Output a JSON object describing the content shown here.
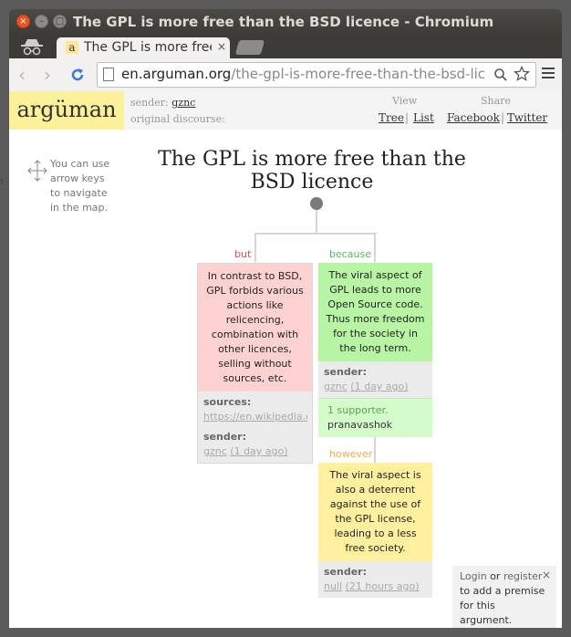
{
  "window": {
    "title": "The GPL is more free than the BSD licence - Chromium",
    "close": "×",
    "min": "–",
    "max": "□"
  },
  "tab": {
    "label": "The GPL is more free than the BSD licence",
    "close": "×",
    "favicon": "a"
  },
  "address": {
    "host": "en.arguman.org",
    "path": "/the-gpl-is-more-free-than-the-bsd-licence"
  },
  "site": {
    "logo": "argüman",
    "sender_label": "sender:",
    "sender_name": "gznc",
    "discourse_label": "original discourse:",
    "view_label": "View",
    "share_label": "Share",
    "tree": "Tree",
    "list": "List",
    "facebook": "Facebook",
    "twitter": "Twitter",
    "sep": "|"
  },
  "hint": "You can use arrow keys to navigate in the map.",
  "argument": {
    "title": "The GPL is more free than the BSD licence"
  },
  "premises": [
    {
      "relation": "but",
      "text": "In contrast to BSD, GPL forbids various actions like relicencing, combination with other licences, selling without sources, etc.",
      "sources_label": "sources:",
      "sources": "https://en.wikipedia.org/wiki/GNU_General_Public_License",
      "sender_label": "sender:",
      "sender": "gznc",
      "time": "(1 day ago)"
    },
    {
      "relation": "because",
      "text": "The viral aspect of GPL leads to more Open Source code. Thus more freedom for the society in the long term.",
      "sender_label": "sender:",
      "sender": "gznc",
      "time": "(1 day ago)",
      "supporters": "1 supporter.",
      "supporter_name": "pranavashok"
    },
    {
      "relation": "however",
      "text": "The viral aspect is also a deterrent against the use of the GPL license, leading to a less free society.",
      "sender_label": "sender:",
      "sender": "null",
      "time": "(21 hours ago)"
    }
  ],
  "login": {
    "login": "Login",
    "or": " or ",
    "register": "register",
    "rest": "to add a premise for this argument.",
    "close": "×"
  },
  "offscreen_fragment": "on",
  "colors": {
    "but": "#d9534f",
    "because": "#5cb85c",
    "however": "#f0ad4e",
    "logo_bg": "#fbf19a"
  }
}
